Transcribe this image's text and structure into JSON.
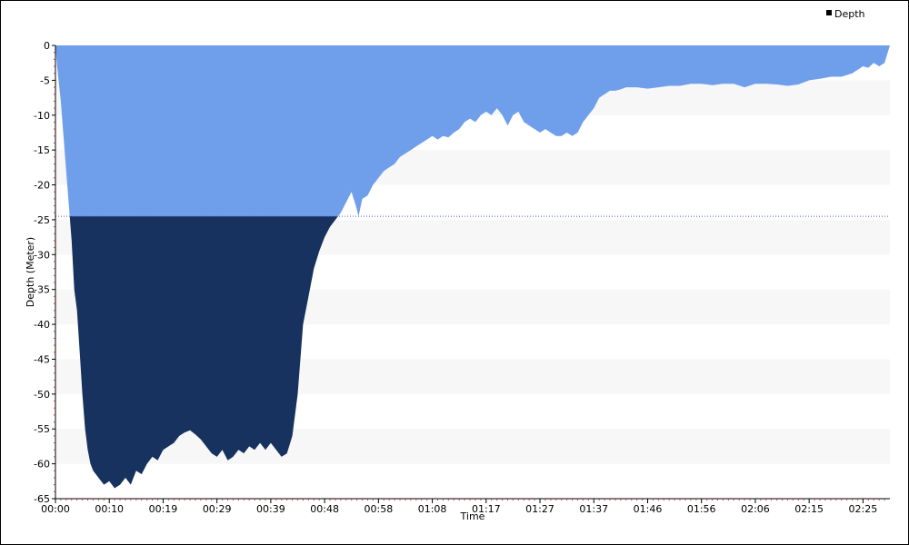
{
  "chart_data": {
    "type": "area",
    "xlabel": "Time",
    "ylabel": "Depth (Meter)",
    "legend": {
      "position": "top-right",
      "entries": [
        {
          "label": "Depth",
          "color": "#000000"
        }
      ]
    },
    "xlim": [
      0,
      155
    ],
    "ylim": [
      -65,
      0
    ],
    "x_ticks": [
      {
        "value": 0,
        "label": "00:00"
      },
      {
        "value": 10,
        "label": "00:10"
      },
      {
        "value": 20,
        "label": "00:19"
      },
      {
        "value": 30,
        "label": "00:29"
      },
      {
        "value": 40,
        "label": "00:39"
      },
      {
        "value": 50,
        "label": "00:48"
      },
      {
        "value": 60,
        "label": "00:58"
      },
      {
        "value": 70,
        "label": "01:08"
      },
      {
        "value": 80,
        "label": "01:17"
      },
      {
        "value": 90,
        "label": "01:27"
      },
      {
        "value": 100,
        "label": "01:37"
      },
      {
        "value": 110,
        "label": "01:46"
      },
      {
        "value": 120,
        "label": "01:56"
      },
      {
        "value": 130,
        "label": "02:06"
      },
      {
        "value": 140,
        "label": "02:15"
      },
      {
        "value": 150,
        "label": "02:25"
      }
    ],
    "y_ticks": [
      0,
      -5,
      -10,
      -15,
      -20,
      -25,
      -30,
      -35,
      -40,
      -45,
      -50,
      -55,
      -60,
      -65
    ],
    "threshold": -24.5,
    "grid": "alternating horizontal bands",
    "colors": {
      "upper_fill": "#6f9fea",
      "lower_fill": "#17325f",
      "threshold_line": "#4a5fd0",
      "band": "#f7f7f7"
    },
    "series": [
      {
        "name": "Depth",
        "points": [
          [
            0,
            0
          ],
          [
            0.3,
            -3
          ],
          [
            1,
            -8
          ],
          [
            2,
            -18
          ],
          [
            3,
            -28
          ],
          [
            3.5,
            -35
          ],
          [
            4,
            -38
          ],
          [
            4.5,
            -44
          ],
          [
            5,
            -50
          ],
          [
            5.5,
            -55
          ],
          [
            6,
            -58
          ],
          [
            6.5,
            -60
          ],
          [
            7,
            -61
          ],
          [
            8,
            -62
          ],
          [
            9,
            -63
          ],
          [
            10,
            -62.5
          ],
          [
            11,
            -63.5
          ],
          [
            12,
            -63
          ],
          [
            13,
            -62
          ],
          [
            14,
            -63
          ],
          [
            15,
            -61
          ],
          [
            16,
            -61.5
          ],
          [
            17,
            -60
          ],
          [
            18,
            -59
          ],
          [
            19,
            -59.5
          ],
          [
            20,
            -58
          ],
          [
            21,
            -57.5
          ],
          [
            22,
            -57
          ],
          [
            23,
            -56
          ],
          [
            24,
            -55.5
          ],
          [
            25,
            -55.2
          ],
          [
            26,
            -55.8
          ],
          [
            27,
            -56.5
          ],
          [
            28,
            -57.5
          ],
          [
            29,
            -58.5
          ],
          [
            30,
            -59
          ],
          [
            31,
            -58
          ],
          [
            32,
            -59.5
          ],
          [
            33,
            -59
          ],
          [
            34,
            -58
          ],
          [
            35,
            -58.5
          ],
          [
            36,
            -57.5
          ],
          [
            37,
            -58
          ],
          [
            38,
            -57
          ],
          [
            39,
            -58
          ],
          [
            40,
            -57
          ],
          [
            41,
            -58
          ],
          [
            42,
            -59
          ],
          [
            43,
            -58.5
          ],
          [
            44,
            -56
          ],
          [
            45,
            -50
          ],
          [
            46,
            -40
          ],
          [
            47,
            -36
          ],
          [
            48,
            -32
          ],
          [
            49,
            -29.5
          ],
          [
            50,
            -27.5
          ],
          [
            51,
            -26
          ],
          [
            52,
            -25
          ],
          [
            53,
            -24
          ],
          [
            54,
            -22.5
          ],
          [
            55,
            -21
          ],
          [
            55.8,
            -23
          ],
          [
            56.3,
            -24.5
          ],
          [
            57,
            -22
          ],
          [
            58,
            -21.5
          ],
          [
            59,
            -20
          ],
          [
            60,
            -19
          ],
          [
            61,
            -18
          ],
          [
            62,
            -17.5
          ],
          [
            63,
            -17
          ],
          [
            64,
            -16
          ],
          [
            65,
            -15.5
          ],
          [
            66,
            -15
          ],
          [
            67,
            -14.5
          ],
          [
            68,
            -14
          ],
          [
            69,
            -13.5
          ],
          [
            70,
            -13
          ],
          [
            71,
            -13.5
          ],
          [
            72,
            -13
          ],
          [
            73,
            -13.2
          ],
          [
            74,
            -12.5
          ],
          [
            75,
            -12
          ],
          [
            76,
            -11
          ],
          [
            77,
            -10.5
          ],
          [
            78,
            -11
          ],
          [
            79,
            -10
          ],
          [
            80,
            -9.5
          ],
          [
            81,
            -10
          ],
          [
            82,
            -9
          ],
          [
            83,
            -10
          ],
          [
            84,
            -11.5
          ],
          [
            85,
            -10
          ],
          [
            86,
            -9.5
          ],
          [
            87,
            -11
          ],
          [
            88,
            -11.5
          ],
          [
            89,
            -12
          ],
          [
            90,
            -12.5
          ],
          [
            91,
            -12
          ],
          [
            92,
            -12.5
          ],
          [
            93,
            -13
          ],
          [
            94,
            -13
          ],
          [
            95,
            -12.5
          ],
          [
            96,
            -13
          ],
          [
            97,
            -12.5
          ],
          [
            98,
            -11
          ],
          [
            99,
            -10
          ],
          [
            100,
            -9
          ],
          [
            101,
            -7.5
          ],
          [
            102,
            -7
          ],
          [
            103,
            -6.5
          ],
          [
            104,
            -6.5
          ],
          [
            105,
            -6.3
          ],
          [
            106,
            -6
          ],
          [
            108,
            -6
          ],
          [
            110,
            -6.2
          ],
          [
            112,
            -6
          ],
          [
            114,
            -5.8
          ],
          [
            116,
            -5.8
          ],
          [
            118,
            -5.5
          ],
          [
            120,
            -5.5
          ],
          [
            122,
            -5.7
          ],
          [
            124,
            -5.5
          ],
          [
            126,
            -5.5
          ],
          [
            128,
            -6
          ],
          [
            130,
            -5.5
          ],
          [
            132,
            -5.5
          ],
          [
            134,
            -5.6
          ],
          [
            136,
            -5.8
          ],
          [
            138,
            -5.6
          ],
          [
            140,
            -5
          ],
          [
            142,
            -4.8
          ],
          [
            144,
            -4.5
          ],
          [
            146,
            -4.5
          ],
          [
            148,
            -4
          ],
          [
            149,
            -3.5
          ],
          [
            150,
            -3
          ],
          [
            151,
            -3.2
          ],
          [
            152,
            -2.5
          ],
          [
            153,
            -3
          ],
          [
            154,
            -2.5
          ],
          [
            155,
            0
          ]
        ]
      }
    ]
  }
}
